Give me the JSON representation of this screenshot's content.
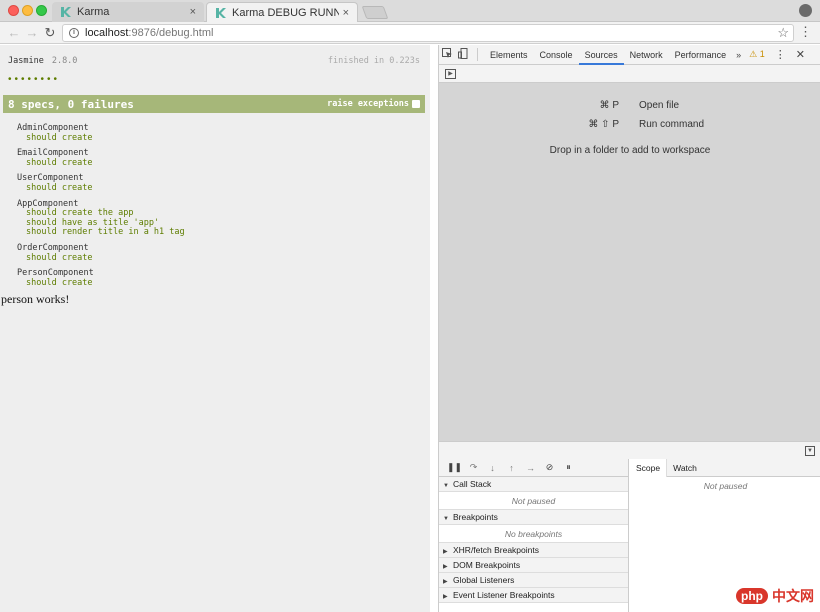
{
  "browser": {
    "tabs": [
      {
        "title": "Karma",
        "close": "×"
      },
      {
        "title": "Karma DEBUG RUNNER",
        "close": "×"
      }
    ],
    "url_host": "localhost",
    "url_rest": ":9876/debug.html",
    "icons": {
      "back": "←",
      "forward": "→",
      "reload": "↻",
      "info": "i",
      "star": "☆",
      "menu": "⋮"
    }
  },
  "jasmine": {
    "title": "Jasmine",
    "version": "2.8.0",
    "duration": "finished in 0.223s",
    "dots": "••••••••",
    "summary": "8 specs, 0 failures",
    "raise_exceptions": "raise exceptions",
    "suites": [
      {
        "name": "AdminComponent",
        "specs": [
          "should create"
        ]
      },
      {
        "name": "EmailComponent",
        "specs": [
          "should create"
        ]
      },
      {
        "name": "UserComponent",
        "specs": [
          "should create"
        ]
      },
      {
        "name": "AppComponent",
        "specs": [
          "should create the app",
          "should have as title 'app'",
          "should render title in a h1 tag"
        ]
      },
      {
        "name": "OrderComponent",
        "specs": [
          "should create"
        ]
      },
      {
        "name": "PersonComponent",
        "specs": [
          "should create"
        ]
      }
    ],
    "page_output": "person works!"
  },
  "devtools": {
    "tabs": [
      "Elements",
      "Console",
      "Sources",
      "Network",
      "Performance"
    ],
    "active_tab": "Sources",
    "more": "»",
    "warning": "⚠ 1",
    "kebab": "⋮",
    "close": "✕",
    "shortcuts": [
      {
        "keys": "⌘ P",
        "label": "Open file"
      },
      {
        "keys": "⌘ ⇧ P",
        "label": "Run command"
      }
    ],
    "drop_hint": "Drop in a folder to add to workspace",
    "sections": {
      "call_stack": "Call Stack",
      "call_stack_body": "Not paused",
      "breakpoints": "Breakpoints",
      "breakpoints_body": "No breakpoints",
      "xhr": "XHR/fetch Breakpoints",
      "dom": "DOM Breakpoints",
      "global": "Global Listeners",
      "event": "Event Listener Breakpoints"
    },
    "scope_tabs": [
      "Scope",
      "Watch"
    ],
    "scope_body": "Not paused"
  },
  "watermark": {
    "logo": "php",
    "text": "中文网"
  },
  "colors": {
    "summary_bg": "#a6b779",
    "spec_green": "#5e7d00",
    "accent_blue": "#3879d9"
  }
}
